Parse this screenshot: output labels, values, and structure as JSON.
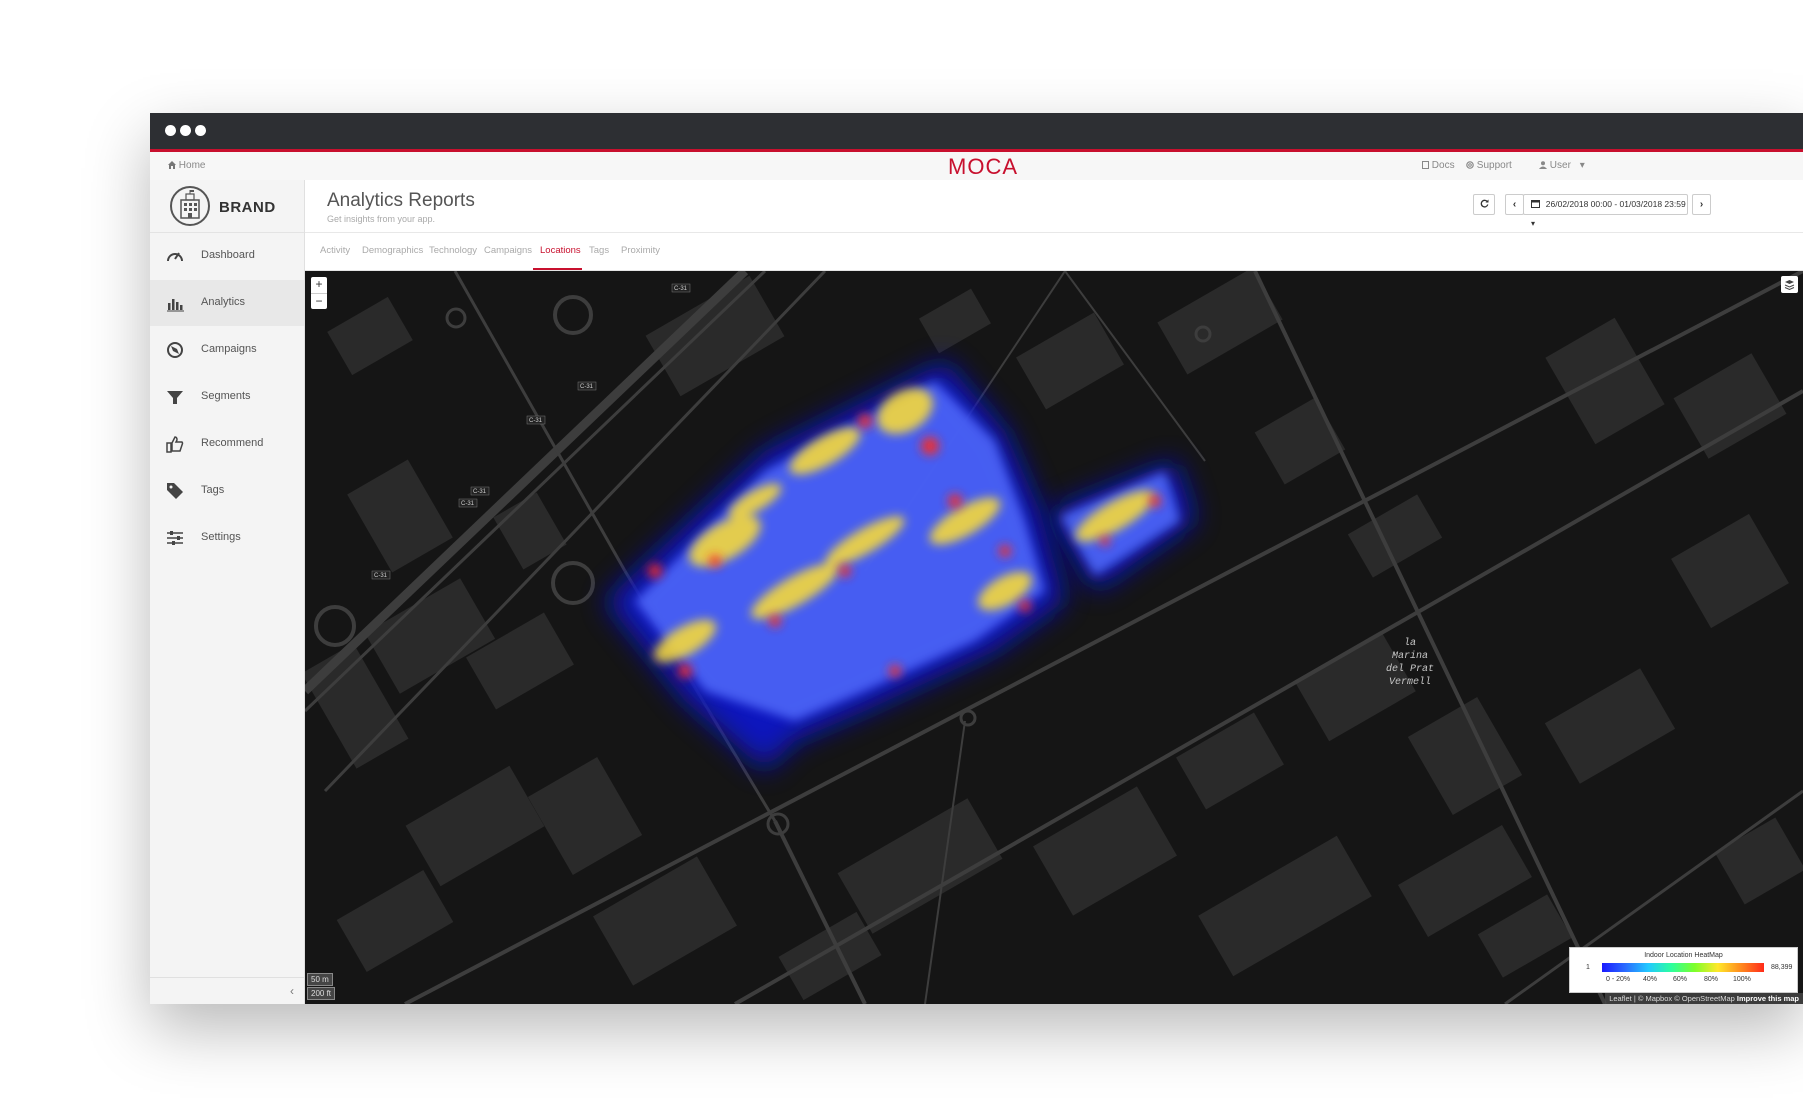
{
  "browser": {
    "dots": 3
  },
  "topnav": {
    "home_label": "Home",
    "logo": "MOCA",
    "docs_label": "Docs",
    "support_label": "Support",
    "user_label": "User"
  },
  "sidebar": {
    "brand": "BRAND",
    "items": [
      {
        "label": "Dashboard",
        "icon": "gauge-icon"
      },
      {
        "label": "Analytics",
        "icon": "bar-chart-icon",
        "active": true
      },
      {
        "label": "Campaigns",
        "icon": "compass-icon"
      },
      {
        "label": "Segments",
        "icon": "funnel-icon"
      },
      {
        "label": "Recommend",
        "icon": "thumbs-up-icon"
      },
      {
        "label": "Tags",
        "icon": "tag-icon"
      },
      {
        "label": "Settings",
        "icon": "sliders-icon"
      }
    ],
    "collapse_glyph": "‹"
  },
  "header": {
    "title": "Analytics Reports",
    "subtitle": "Get insights from your app.",
    "date_range": "26/02/2018 00:00 - 01/03/2018 23:59"
  },
  "tabs": [
    "Activity",
    "Demographics",
    "Technology",
    "Campaigns",
    "Locations",
    "Tags",
    "Proximity"
  ],
  "active_tab": "Locations",
  "map": {
    "zoom_in": "+",
    "zoom_out": "−",
    "scale_metric": "50 m",
    "scale_imperial": "200 ft",
    "road_labels": [
      "C-31",
      "C-31",
      "C-31",
      "C-31",
      "C-31",
      "C-31"
    ],
    "place_label_lines": [
      "la",
      "Marina",
      "del Prat",
      "Vermell"
    ],
    "attribution": "Leaflet | © Mapbox © OpenStreetMap",
    "attribution_link": "Improve this map"
  },
  "legend": {
    "title": "Indoor Location HeatMap",
    "min": "1",
    "max": "88,399",
    "ticks": [
      "0 - 20%",
      "40%",
      "60%",
      "80%",
      "100%"
    ]
  },
  "colors": {
    "accent": "#c8102e",
    "map_bg": "#151515"
  }
}
